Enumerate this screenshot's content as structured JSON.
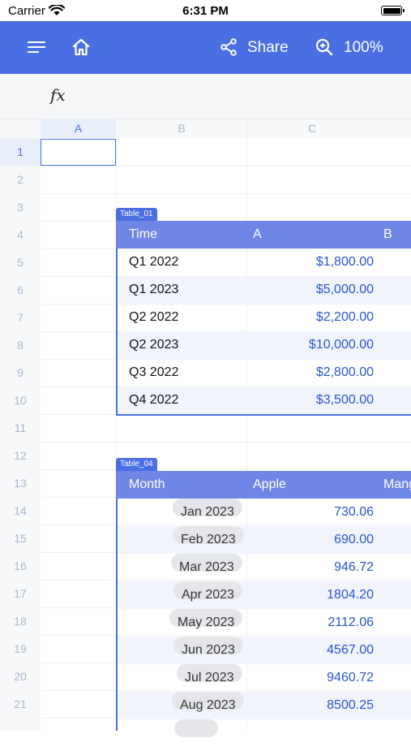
{
  "status_bar": {
    "carrier": "Carrier",
    "time": "6:31 PM"
  },
  "toolbar": {
    "share_label": "Share",
    "zoom_label": "100%"
  },
  "formula_bar": {
    "fx_label": "fx"
  },
  "columns": [
    "A",
    "B",
    "C"
  ],
  "rows": [
    "1",
    "2",
    "3",
    "4",
    "5",
    "6",
    "7",
    "8",
    "9",
    "10",
    "11",
    "12",
    "13",
    "14",
    "15",
    "16",
    "17",
    "18",
    "19",
    "20",
    "21"
  ],
  "table_01": {
    "name": "Table_01",
    "headers": [
      "Time",
      "A",
      "B"
    ],
    "rows": [
      {
        "label": "Q1 2022",
        "value": "$1,800.00"
      },
      {
        "label": "Q1 2023",
        "value": "$5,000.00"
      },
      {
        "label": "Q2 2022",
        "value": "$2,200.00"
      },
      {
        "label": "Q2 2023",
        "value": "$10,000.00"
      },
      {
        "label": "Q3 2022",
        "value": "$2,800.00"
      },
      {
        "label": "Q4 2022",
        "value": "$3,500.00"
      }
    ]
  },
  "table_04": {
    "name": "Table_04",
    "headers": [
      "Month",
      "Apple",
      "Mang"
    ],
    "rows": [
      {
        "label": "Jan 2023",
        "value": "730.06"
      },
      {
        "label": "Feb 2023",
        "value": "690.00"
      },
      {
        "label": "Mar 2023",
        "value": "946.72"
      },
      {
        "label": "Apr 2023",
        "value": "1804.20"
      },
      {
        "label": "May 2023",
        "value": "2112.06"
      },
      {
        "label": "Jun 2023",
        "value": "4567.00"
      },
      {
        "label": "Jul 2023",
        "value": "9460.72"
      },
      {
        "label": "Aug 2023",
        "value": "8500.25"
      }
    ]
  },
  "colors": {
    "accent": "#4a6fe3",
    "table_header": "#6e86e6",
    "value_text": "#2a55c8"
  }
}
